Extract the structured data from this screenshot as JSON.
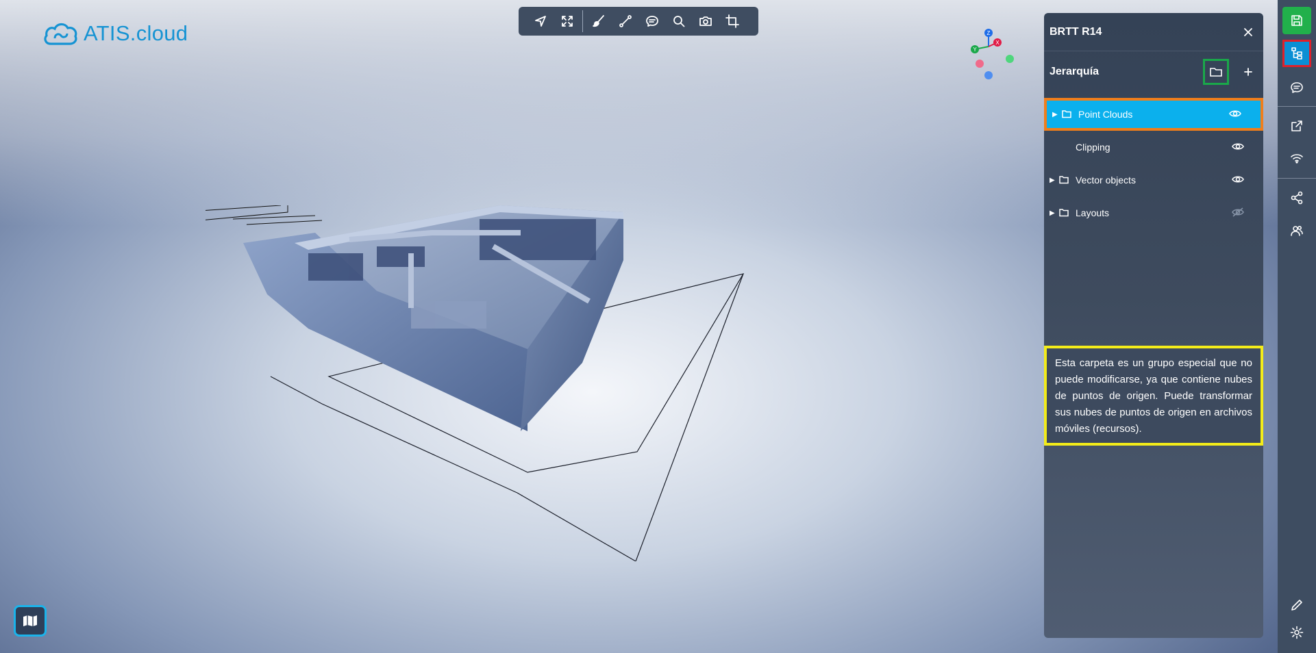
{
  "app": {
    "brand": "ATIS.cloud"
  },
  "toolbar": {
    "tools": [
      {
        "name": "navigate",
        "icon": "navigate-arrow-icon"
      },
      {
        "name": "fit",
        "icon": "fullscreen-icon"
      },
      {
        "name": "paint",
        "icon": "brush-icon"
      },
      {
        "name": "measure",
        "icon": "measure-line-icon"
      },
      {
        "name": "comment",
        "icon": "comment-icon"
      },
      {
        "name": "search",
        "icon": "search-icon"
      },
      {
        "name": "screenshot",
        "icon": "camera-icon"
      },
      {
        "name": "crop",
        "icon": "crop-icon"
      }
    ]
  },
  "gizmo": {
    "labels": [
      "Z",
      "X",
      "Y"
    ]
  },
  "panel": {
    "title": "BRTT R14",
    "section_title": "Jerarquía",
    "tree": [
      {
        "label": "Point Clouds",
        "expandable": true,
        "folder": true,
        "visible": true,
        "selected": true
      },
      {
        "label": "Clipping",
        "expandable": false,
        "folder": false,
        "visible": true,
        "selected": false
      },
      {
        "label": "Vector objects",
        "expandable": true,
        "folder": true,
        "visible": true,
        "selected": false
      },
      {
        "label": "Layouts",
        "expandable": true,
        "folder": true,
        "visible": false,
        "selected": false
      }
    ],
    "info": "Esta carpeta es un grupo especial que no puede modificarse, ya que contiene nubes de puntos de origen. Puede transformar sus nubes de puntos de origen en archivos móviles (recursos)."
  },
  "rail": {
    "items": [
      "save-icon",
      "hierarchy-icon",
      "comments-icon",
      "external-link-icon",
      "wifi-icon",
      "share-icon",
      "users-icon",
      "edit-icon",
      "settings-icon"
    ]
  },
  "colors": {
    "selected_row": "#0bb0ed",
    "selected_outline": "#f07e1b",
    "folder_button_outline": "#1aa84a",
    "info_outline": "#f3ec19",
    "save_button": "#21b04b",
    "active_rail_outline": "#e0202a"
  }
}
